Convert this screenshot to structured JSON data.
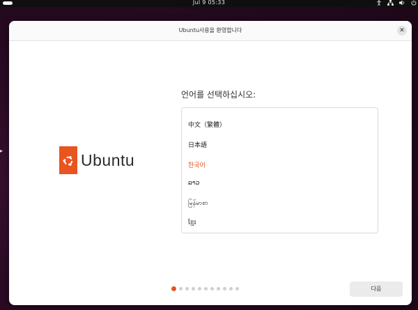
{
  "topbar": {
    "clock": "Jul 9  05:33",
    "icons": [
      "activities-indicator",
      "accessibility-icon",
      "network-icon",
      "volume-icon",
      "power-icon"
    ]
  },
  "window": {
    "title": "Ubuntu사용을 환영합니다",
    "close_icon": "close-icon"
  },
  "logo": {
    "text": "Ubuntu",
    "brand_color": "#E95420"
  },
  "language_page": {
    "prompt": "언어를 선택하십시오:",
    "languages": [
      "中文（繁體）",
      "日本語",
      "한국어",
      "ລາວ",
      "မြန်မာစာ",
      "ខ្មែរ"
    ],
    "selected": "한국어"
  },
  "pagination": {
    "total": 11,
    "current": 1,
    "active_color": "#E95420"
  },
  "buttons": {
    "next_label": "다음"
  }
}
